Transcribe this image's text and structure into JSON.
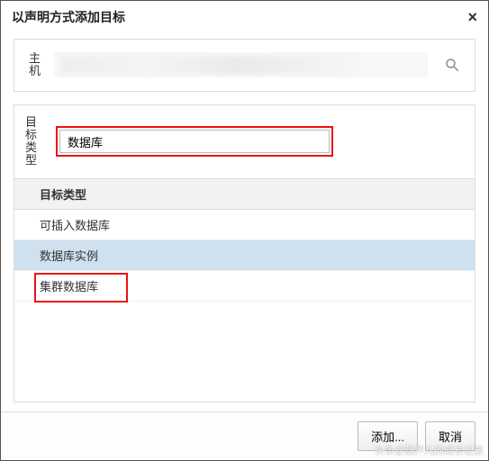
{
  "dialog": {
    "title": "以声明方式添加目标",
    "close_label": "×"
  },
  "host": {
    "label": "主机",
    "value": ""
  },
  "target_type": {
    "label": "目标类型",
    "input_value": "数据库",
    "header": "目标类型",
    "items": [
      {
        "label": "可插入数据库",
        "selected": false,
        "highlight": false
      },
      {
        "label": "数据库实例",
        "selected": true,
        "highlight": false
      },
      {
        "label": "集群数据库",
        "selected": false,
        "highlight": true
      }
    ]
  },
  "footer": {
    "add_label": "添加...",
    "cancel_label": "取消"
  },
  "watermark": "头条@葫芦儿的成长记录"
}
